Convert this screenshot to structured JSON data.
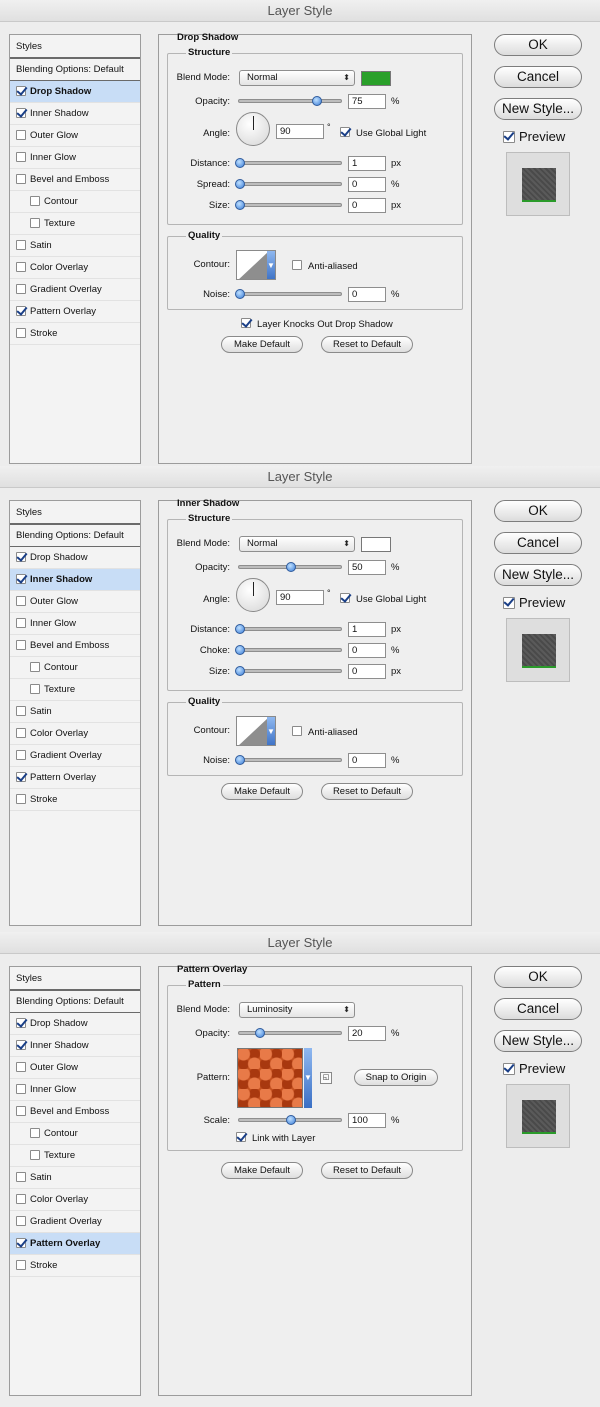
{
  "dialogs": [
    {
      "title": "Layer Style",
      "section_title": "Drop Shadow",
      "selected_index": 1,
      "styles": [
        {
          "label": "Styles",
          "checked": null
        },
        {
          "label": "Blending Options: Default",
          "checked": null
        },
        {
          "label": "Drop Shadow",
          "checked": true
        },
        {
          "label": "Inner Shadow",
          "checked": true
        },
        {
          "label": "Outer Glow",
          "checked": false
        },
        {
          "label": "Inner Glow",
          "checked": false
        },
        {
          "label": "Bevel and Emboss",
          "checked": false
        },
        {
          "label": "Contour",
          "checked": false
        },
        {
          "label": "Texture",
          "checked": false
        },
        {
          "label": "Satin",
          "checked": false
        },
        {
          "label": "Color Overlay",
          "checked": false
        },
        {
          "label": "Gradient Overlay",
          "checked": false
        },
        {
          "label": "Pattern Overlay",
          "checked": true
        },
        {
          "label": "Stroke",
          "checked": false
        }
      ]
    },
    {
      "title": "Layer Style",
      "section_title": "Inner Shadow",
      "selected_index": 2,
      "styles": [
        {
          "label": "Styles",
          "checked": null
        },
        {
          "label": "Blending Options: Default",
          "checked": null
        },
        {
          "label": "Drop Shadow",
          "checked": true
        },
        {
          "label": "Inner Shadow",
          "checked": true
        },
        {
          "label": "Outer Glow",
          "checked": false
        },
        {
          "label": "Inner Glow",
          "checked": false
        },
        {
          "label": "Bevel and Emboss",
          "checked": false
        },
        {
          "label": "Contour",
          "checked": false
        },
        {
          "label": "Texture",
          "checked": false
        },
        {
          "label": "Satin",
          "checked": false
        },
        {
          "label": "Color Overlay",
          "checked": false
        },
        {
          "label": "Gradient Overlay",
          "checked": false
        },
        {
          "label": "Pattern Overlay",
          "checked": true
        },
        {
          "label": "Stroke",
          "checked": false
        }
      ]
    },
    {
      "title": "Layer Style",
      "section_title": "Pattern Overlay",
      "selected_index": 11,
      "styles": [
        {
          "label": "Styles",
          "checked": null
        },
        {
          "label": "Blending Options: Default",
          "checked": null
        },
        {
          "label": "Drop Shadow",
          "checked": true
        },
        {
          "label": "Inner Shadow",
          "checked": true
        },
        {
          "label": "Outer Glow",
          "checked": false
        },
        {
          "label": "Inner Glow",
          "checked": false
        },
        {
          "label": "Bevel and Emboss",
          "checked": false
        },
        {
          "label": "Contour",
          "checked": false
        },
        {
          "label": "Texture",
          "checked": false
        },
        {
          "label": "Satin",
          "checked": false
        },
        {
          "label": "Color Overlay",
          "checked": false
        },
        {
          "label": "Gradient Overlay",
          "checked": false
        },
        {
          "label": "Pattern Overlay",
          "checked": true
        },
        {
          "label": "Stroke",
          "checked": false
        }
      ]
    }
  ],
  "labels": {
    "structure": "Structure",
    "quality": "Quality",
    "pattern_group": "Pattern",
    "blend_mode": "Blend Mode:",
    "opacity": "Opacity:",
    "angle": "Angle:",
    "use_global_light": "Use Global Light",
    "distance": "Distance:",
    "spread": "Spread:",
    "choke": "Choke:",
    "size": "Size:",
    "contour": "Contour:",
    "anti_aliased": "Anti-aliased",
    "noise": "Noise:",
    "layer_knocks_out": "Layer Knocks Out Drop Shadow",
    "make_default": "Make Default",
    "reset_to_default": "Reset to Default",
    "pattern": "Pattern:",
    "snap_to_origin": "Snap to Origin",
    "scale": "Scale:",
    "link_with_layer": "Link with Layer",
    "ok": "OK",
    "cancel": "Cancel",
    "new_style": "New Style...",
    "preview": "Preview",
    "percent": "%",
    "px": "px",
    "degree": "°"
  },
  "drop_shadow": {
    "blend_mode": "Normal",
    "color": "#2aa02a",
    "opacity": "75",
    "opacity_level": 0.75,
    "angle": "90",
    "use_global_light": true,
    "distance": "1",
    "spread": "0",
    "size": "0",
    "anti_aliased": false,
    "noise": "0",
    "layer_knocks_out": true
  },
  "inner_shadow": {
    "blend_mode": "Normal",
    "color": "#ffffff",
    "opacity": "50",
    "opacity_level": 0.5,
    "angle": "90",
    "use_global_light": true,
    "distance": "1",
    "choke": "0",
    "size": "0",
    "anti_aliased": false,
    "noise": "0"
  },
  "pattern_overlay": {
    "blend_mode": "Luminosity",
    "opacity": "20",
    "opacity_level": 0.2,
    "scale": "100",
    "scale_level": 0.5,
    "link_with_layer": true
  },
  "icons": {
    "select_arrow": "⬍",
    "dropdown_arrow": "▼"
  }
}
